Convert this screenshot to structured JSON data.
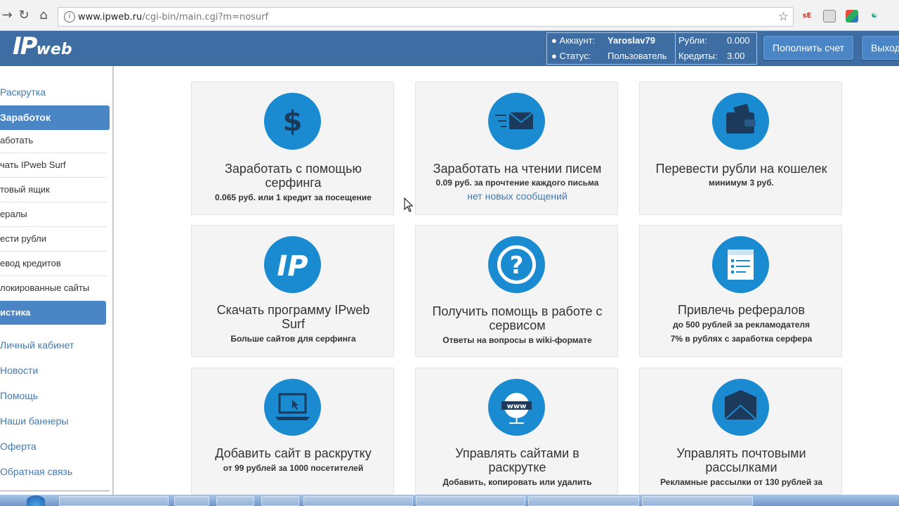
{
  "browser": {
    "url_host": "www.ipweb.ru",
    "url_path": "/cgi-bin/main.cgi?m=nosurf"
  },
  "header": {
    "logo_ip": "IP",
    "logo_web": "web",
    "account_label": "Аккаунт:",
    "account_value": "Yaroslav79",
    "status_label": "Статус:",
    "status_value": "Пользователь",
    "rubles_label": "Рубли:",
    "rubles_value": "0.000",
    "credits_label": "Кредиты:",
    "credits_value": "3.00",
    "topup_button": "Пополнить счет",
    "logout_button": "Выход"
  },
  "sidebar": {
    "promotion": "Раскрутка",
    "earnings_active": "Заработок",
    "earnings_items": [
      "аботать",
      "чать IPweb Surf",
      "товый ящик",
      "ералы",
      "ести рубли",
      "евод кредитов",
      "локированные сайты"
    ],
    "stats_active": "истика",
    "links": [
      "Личный кабинет",
      "Новости",
      "Помощь",
      "Наши баннеры",
      "Оферта",
      "Обратная связь"
    ]
  },
  "cards": [
    {
      "icon": "dollar-icon",
      "title": "Заработать с помощью серфинга",
      "sub": "0.065 руб. или 1 кредит за посещение"
    },
    {
      "icon": "mail-fast-icon",
      "title": "Заработать на чтении писем",
      "sub": "0.09 руб. за прочтение каждого письма",
      "link": "нет новых сообщений"
    },
    {
      "icon": "wallet-icon",
      "title": "Перевести рубли на кошелек",
      "sub": "минимум 3 руб."
    },
    {
      "icon": "ip-logo-icon",
      "title": "Скачать программу IPweb Surf",
      "sub": "Больше сайтов для серфинга"
    },
    {
      "icon": "question-icon",
      "title": "Получить помощь в работе с сервисом",
      "sub": "Ответы на вопросы в wiki-формате"
    },
    {
      "icon": "form-icon",
      "title": "Привлечь рефералов",
      "sub": "до 500 рублей за рекламодателя",
      "sub2": "7% в рублях с заработка серфера"
    },
    {
      "icon": "laptop-icon",
      "title": "Добавить сайт в раскрутку",
      "sub": "от 99 рублей за 1000 посетителей"
    },
    {
      "icon": "www-globe-icon",
      "title": "Управлять сайтами в раскрутке",
      "sub": "Добавить, копировать или удалить"
    },
    {
      "icon": "envelope-icon",
      "title": "Управлять почтовыми рассылками",
      "sub": "Рекламные рассылки от 130 рублей за"
    }
  ],
  "colors": {
    "header": "#3d6da3",
    "accent": "#4a86c5",
    "icon": "#1a8bd0",
    "link": "#3d7ab8"
  }
}
